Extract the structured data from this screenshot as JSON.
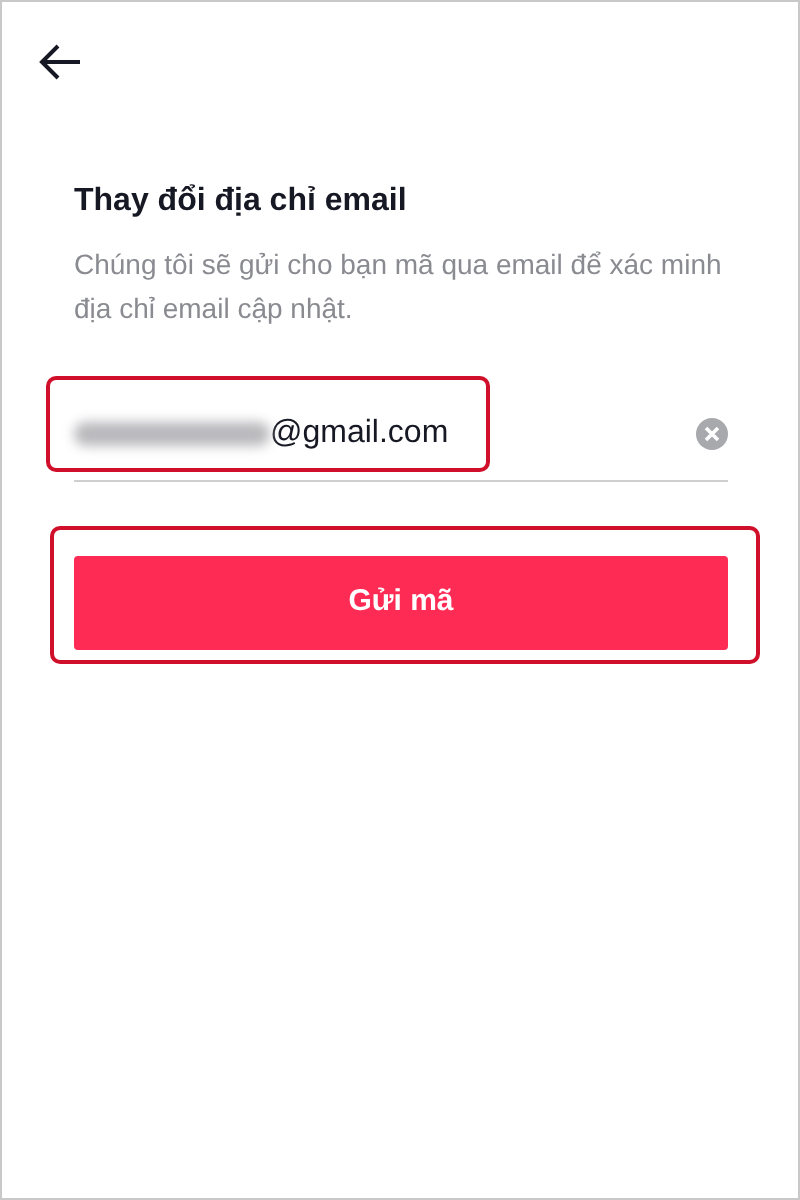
{
  "title": "Thay đổi địa chỉ email",
  "description": "Chúng tôi sẽ gửi cho bạn mã qua email để xác minh địa chỉ email cập nhật.",
  "email_field": {
    "value": "@gmail.com",
    "blurred_prefix": true,
    "highlighted": true
  },
  "submit_button": {
    "label": "Gửi mã",
    "highlighted": true
  }
}
